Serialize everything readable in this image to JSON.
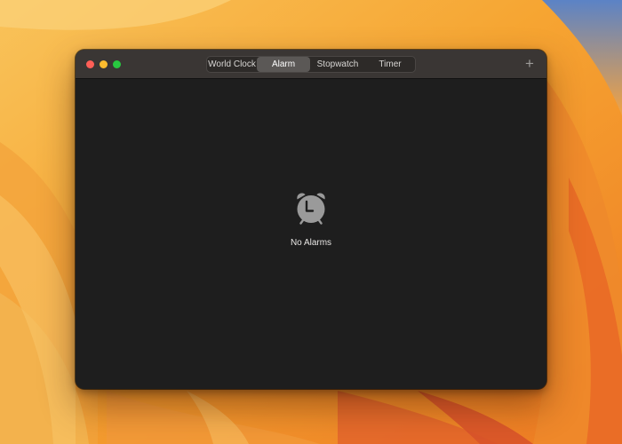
{
  "window": {
    "tabs": [
      {
        "label": "World Clock"
      },
      {
        "label": "Alarm"
      },
      {
        "label": "Stopwatch"
      },
      {
        "label": "Timer"
      }
    ],
    "active_tab": "Alarm",
    "add_button_glyph": "+"
  },
  "empty_state": {
    "icon": "alarm-clock-icon",
    "label": "No Alarms"
  },
  "colors": {
    "close": "#ff5f57",
    "minimize": "#febc2e",
    "maximize": "#28c840",
    "window_bg": "#1e1e1e",
    "titlebar_bg": "#3a3634"
  }
}
